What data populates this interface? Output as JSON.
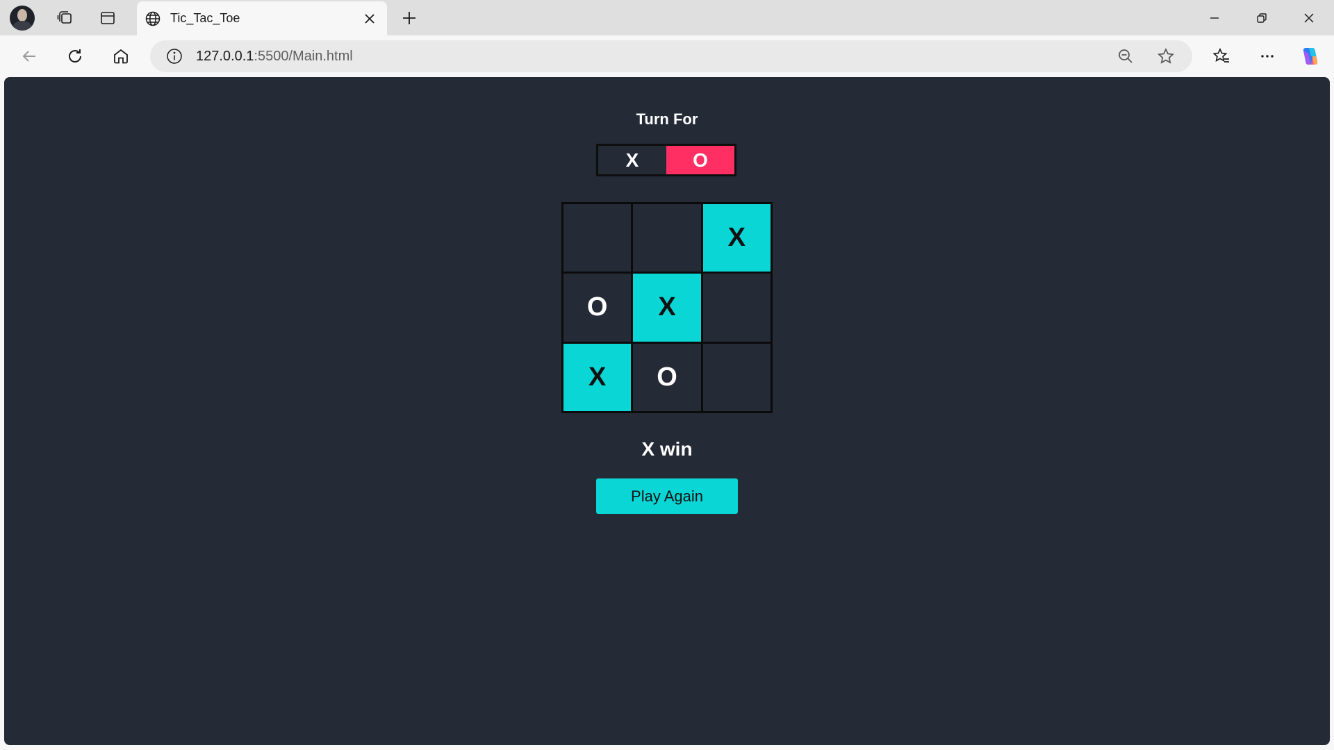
{
  "browser": {
    "tab_title": "Tic_Tac_Toe",
    "url_host": "127.0.0.1",
    "url_rest": ":5500/Main.html",
    "icons": [
      "avatar",
      "workspaces-icon",
      "vertical-tabs-icon",
      "globe-icon",
      "close-icon",
      "plus-icon",
      "minimize-icon",
      "restore-icon",
      "close-window-icon",
      "back-icon",
      "refresh-icon",
      "home-icon",
      "info-icon",
      "zoom-out-icon",
      "star-icon",
      "favorites-icon",
      "more-icon",
      "copilot-icon"
    ]
  },
  "game": {
    "turn_label": "Turn For",
    "turn_x": "X",
    "turn_o": "O",
    "active_turn": "O",
    "board": [
      {
        "value": "",
        "highlight": false
      },
      {
        "value": "",
        "highlight": false
      },
      {
        "value": "X",
        "highlight": true
      },
      {
        "value": "O",
        "highlight": false
      },
      {
        "value": "X",
        "highlight": true
      },
      {
        "value": "",
        "highlight": false
      },
      {
        "value": "X",
        "highlight": true
      },
      {
        "value": "O",
        "highlight": false
      },
      {
        "value": "",
        "highlight": false
      }
    ],
    "result": "X win",
    "play_again": "Play Again"
  },
  "colors": {
    "background": "#252a37",
    "accent_cyan": "#0bd6d6",
    "accent_pink": "#ff2e63"
  }
}
